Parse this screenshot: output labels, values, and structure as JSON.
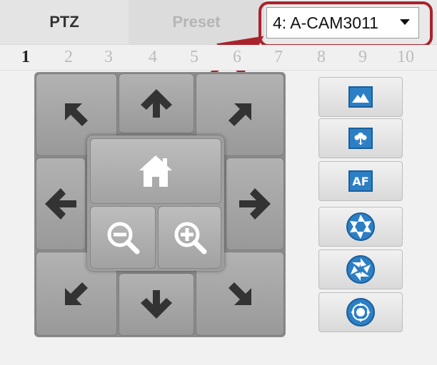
{
  "tabs": {
    "ptz": "PTZ",
    "preset": "Preset"
  },
  "camera_select": {
    "value": "4: A-CAM3011"
  },
  "preset_numbers": [
    "1",
    "2",
    "3",
    "4",
    "5",
    "6",
    "7",
    "8",
    "9",
    "10"
  ],
  "active_preset": "1",
  "icons": {
    "directions": [
      "up-left-arrow-icon",
      "up-arrow-icon",
      "up-right-arrow-icon",
      "left-arrow-icon",
      "right-arrow-icon",
      "down-left-arrow-icon",
      "down-arrow-icon",
      "down-right-arrow-icon"
    ],
    "center": [
      "home-icon",
      "zoom-out-icon",
      "zoom-in-icon"
    ],
    "right_column": [
      "landscape-icon",
      "macro-flower-icon",
      "autofocus-icon",
      "iris-open-icon",
      "iris-close-icon",
      "focus-target-icon"
    ]
  },
  "right_column": {
    "af_label": "AF"
  },
  "colors": {
    "accent_blue": "#2c7fc5",
    "highlight_red": "#a8232c"
  }
}
